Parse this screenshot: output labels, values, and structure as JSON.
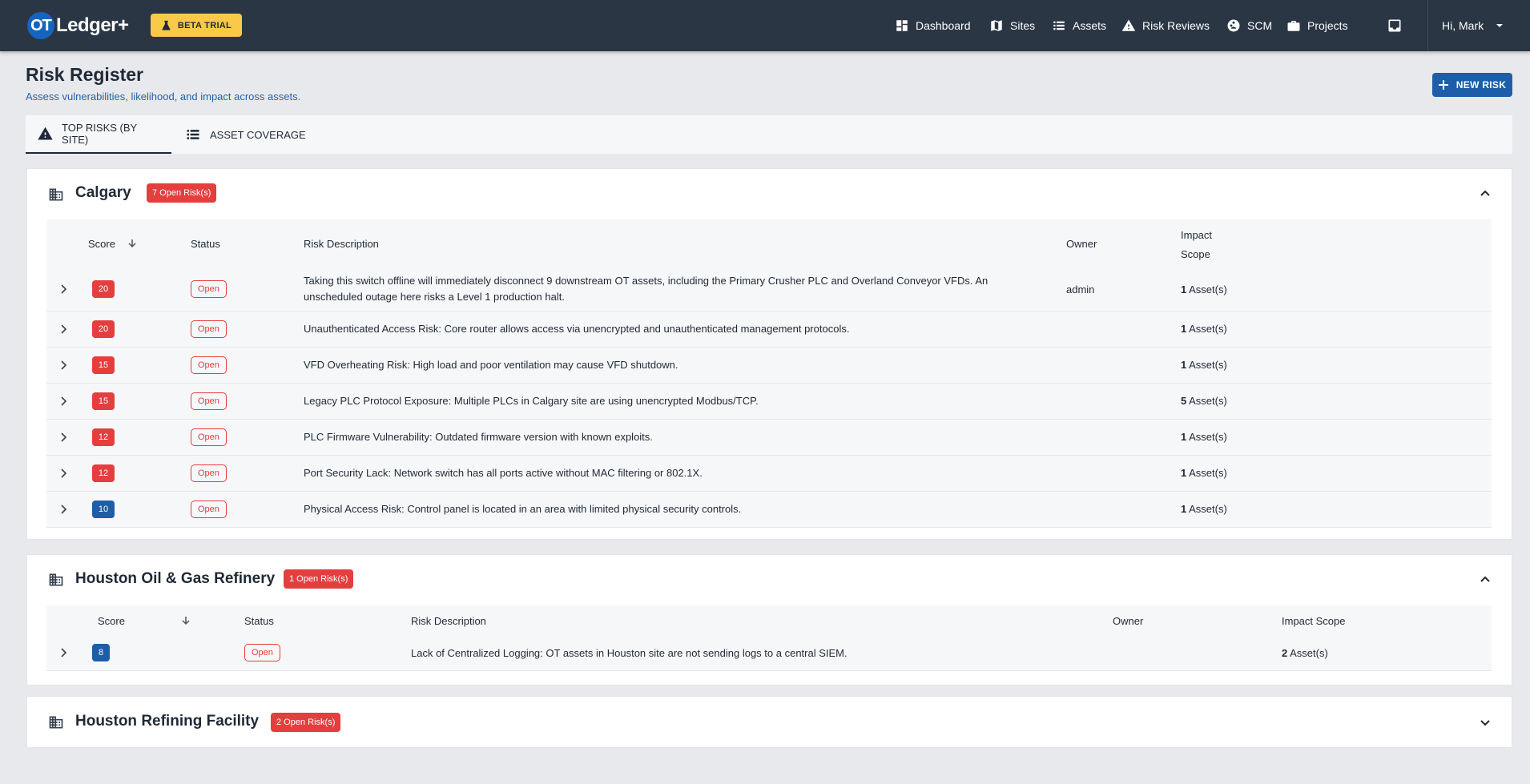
{
  "app": {
    "logo_mark": "OT",
    "logo_text": "Ledger+",
    "beta_label": "BETA TRIAL"
  },
  "nav": {
    "items": [
      {
        "label": "Dashboard",
        "icon": "dashboard-icon"
      },
      {
        "label": "Sites",
        "icon": "map-icon"
      },
      {
        "label": "Assets",
        "icon": "list-icon"
      },
      {
        "label": "Risk Reviews",
        "icon": "warning-icon"
      },
      {
        "label": "SCM",
        "icon": "scm-icon"
      },
      {
        "label": "Projects",
        "icon": "briefcase-icon"
      }
    ],
    "user_greeting": "Hi, Mark"
  },
  "header": {
    "title": "Risk Register",
    "subtitle": "Assess vulnerabilities, likelihood, and impact across assets.",
    "new_risk_label": "NEW RISK"
  },
  "tabs": [
    {
      "label": "TOP RISKS (BY SITE)",
      "active": true
    },
    {
      "label": "ASSET COVERAGE",
      "active": false
    }
  ],
  "columns": {
    "score": "Score",
    "status": "Status",
    "description": "Risk Description",
    "owner": "Owner",
    "impact": "Impact Scope",
    "impact_line1": "Impact",
    "impact_line2": "Scope"
  },
  "sites": [
    {
      "name": "Calgary",
      "badge": "7 Open Risk(s)",
      "expanded": true,
      "risks": [
        {
          "score": "20",
          "level": "red",
          "status": "Open",
          "description": "Taking this switch offline will immediately disconnect 9 downstream OT assets, including the Primary Crusher PLC and Overland Conveyor VFDs. An unscheduled outage here risks a Level 1 production halt.",
          "owner": "admin",
          "assets": "1",
          "assets_label": "Asset(s)"
        },
        {
          "score": "20",
          "level": "red",
          "status": "Open",
          "description": "Unauthenticated Access Risk: Core router allows access via unencrypted and unauthenticated management protocols.",
          "owner": "",
          "assets": "1",
          "assets_label": "Asset(s)"
        },
        {
          "score": "15",
          "level": "red",
          "status": "Open",
          "description": "VFD Overheating Risk: High load and poor ventilation may cause VFD shutdown.",
          "owner": "",
          "assets": "1",
          "assets_label": "Asset(s)"
        },
        {
          "score": "15",
          "level": "red",
          "status": "Open",
          "description": "Legacy PLC Protocol Exposure: Multiple PLCs in Calgary site are using unencrypted Modbus/TCP.",
          "owner": "",
          "assets": "5",
          "assets_label": "Asset(s)"
        },
        {
          "score": "12",
          "level": "red",
          "status": "Open",
          "description": "PLC Firmware Vulnerability: Outdated firmware version with known exploits.",
          "owner": "",
          "assets": "1",
          "assets_label": "Asset(s)"
        },
        {
          "score": "12",
          "level": "red",
          "status": "Open",
          "description": "Port Security Lack: Network switch has all ports active without MAC filtering or 802.1X.",
          "owner": "",
          "assets": "1",
          "assets_label": "Asset(s)"
        },
        {
          "score": "10",
          "level": "blue",
          "status": "Open",
          "description": "Physical Access Risk: Control panel is located in an area with limited physical security controls.",
          "owner": "",
          "assets": "1",
          "assets_label": "Asset(s)"
        }
      ]
    },
    {
      "name": "Houston Oil & Gas Refinery",
      "badge": "1 Open Risk(s)",
      "expanded": true,
      "risks": [
        {
          "score": "8",
          "level": "blue",
          "status": "Open",
          "description": "Lack of Centralized Logging: OT assets in Houston site are not sending logs to a central SIEM.",
          "owner": "",
          "assets": "2",
          "assets_label": "Asset(s)"
        }
      ]
    },
    {
      "name": "Houston Refining Facility",
      "badge": "2 Open Risk(s)",
      "expanded": false,
      "risks": []
    }
  ]
}
